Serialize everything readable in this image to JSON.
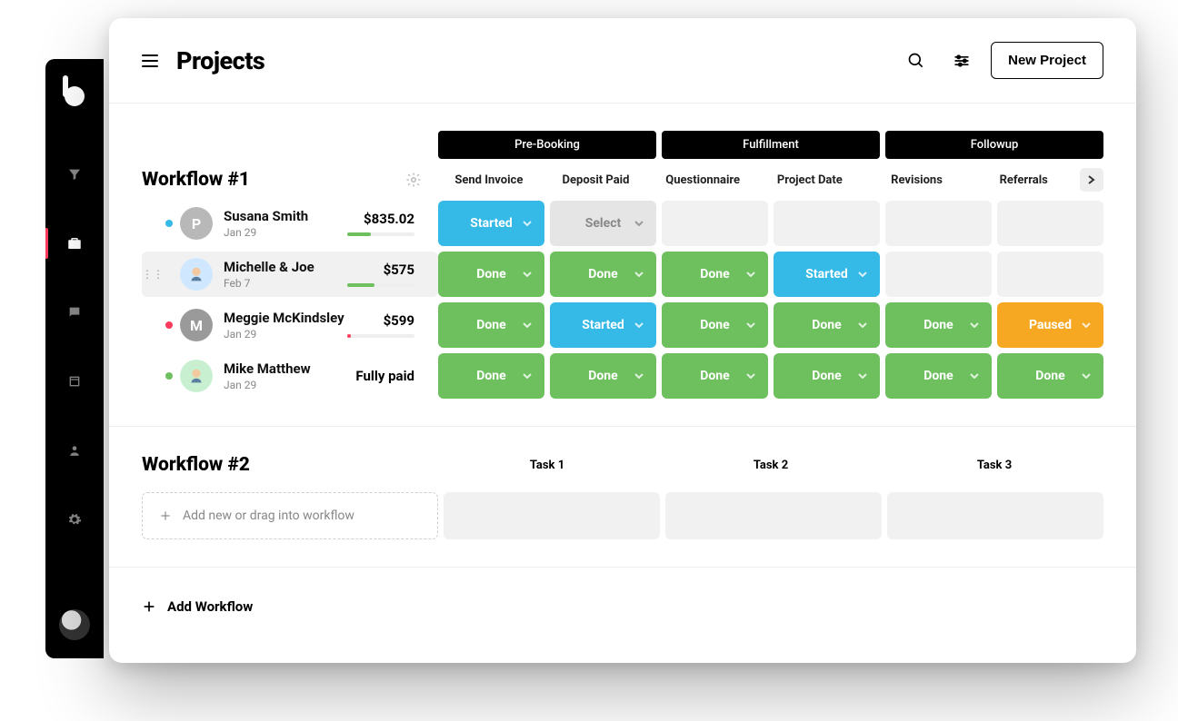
{
  "header": {
    "title": "Projects",
    "new_project_label": "New Project"
  },
  "sidebar": {
    "items": [
      "filter",
      "projects",
      "messages",
      "calendar",
      "contacts",
      "settings"
    ],
    "active_index": 1
  },
  "stages": [
    "Pre-Booking",
    "Fulfillment",
    "Followup"
  ],
  "columns": [
    "Send Invoice",
    "Deposit Paid",
    "Questionnaire",
    "Project Date",
    "Revisions",
    "Referrals"
  ],
  "workflow1": {
    "title": "Workflow #1",
    "rows": [
      {
        "name": "Susana Smith",
        "date": "Jan 29",
        "amount": "$835.02",
        "avatar_letter": "P",
        "avatar_bg": "#b8b8b8",
        "dot_color": "#35b9e6",
        "progress_pct": 35,
        "progress_color": "#6ec05f",
        "highlighted": false,
        "cells": [
          {
            "status": "started",
            "label": "Started"
          },
          {
            "status": "select",
            "label": "Select"
          },
          {
            "status": "empty"
          },
          {
            "status": "empty"
          },
          {
            "status": "empty"
          },
          {
            "status": "empty"
          }
        ]
      },
      {
        "name": "Michelle & Joe",
        "date": "Feb 7",
        "amount": "$575",
        "avatar_letter": "",
        "avatar_bg": "#cfe8ff",
        "avatar_face": true,
        "dot_color": "transparent",
        "progress_pct": 40,
        "progress_color": "#6ec05f",
        "highlighted": true,
        "cells": [
          {
            "status": "done",
            "label": "Done"
          },
          {
            "status": "done",
            "label": "Done"
          },
          {
            "status": "done",
            "label": "Done"
          },
          {
            "status": "started",
            "label": "Started"
          },
          {
            "status": "empty"
          },
          {
            "status": "empty"
          }
        ]
      },
      {
        "name": "Meggie McKindsley",
        "date": "Jan 29",
        "amount": "$599",
        "avatar_letter": "M",
        "avatar_bg": "#9a9a9a",
        "dot_color": "#ff3b5c",
        "progress_pct": 5,
        "progress_color": "#ff3b5c",
        "highlighted": false,
        "cells": [
          {
            "status": "done",
            "label": "Done"
          },
          {
            "status": "started",
            "label": "Started"
          },
          {
            "status": "done",
            "label": "Done"
          },
          {
            "status": "done",
            "label": "Done"
          },
          {
            "status": "done",
            "label": "Done"
          },
          {
            "status": "paused",
            "label": "Paused"
          }
        ]
      },
      {
        "name": "Mike Matthew",
        "date": "Jan 29",
        "amount": "Fully paid",
        "avatar_letter": "",
        "avatar_bg": "#c8f0d0",
        "avatar_face": true,
        "dot_color": "#6ec05f",
        "progress_pct": 0,
        "progress_color": "transparent",
        "highlighted": false,
        "hide_progress": true,
        "cells": [
          {
            "status": "done",
            "label": "Done"
          },
          {
            "status": "done",
            "label": "Done"
          },
          {
            "status": "done",
            "label": "Done"
          },
          {
            "status": "done",
            "label": "Done"
          },
          {
            "status": "done",
            "label": "Done"
          },
          {
            "status": "done",
            "label": "Done"
          }
        ]
      }
    ]
  },
  "workflow2": {
    "title": "Workflow #2",
    "columns": [
      "Task 1",
      "Task 2",
      "Task 3"
    ],
    "add_placeholder": "Add new or drag into workflow"
  },
  "add_workflow_label": "Add Workflow"
}
